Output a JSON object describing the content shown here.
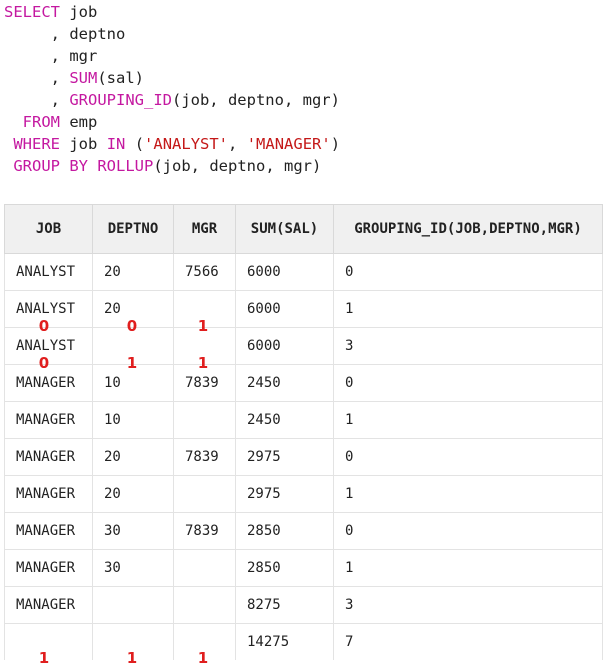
{
  "sql": {
    "lines": [
      [
        {
          "t": "SELECT",
          "c": "kw"
        },
        {
          "t": " job",
          "c": "id"
        }
      ],
      [
        {
          "t": "     , deptno",
          "c": "id"
        }
      ],
      [
        {
          "t": "     , mgr",
          "c": "id"
        }
      ],
      [
        {
          "t": "     , ",
          "c": "id"
        },
        {
          "t": "SUM",
          "c": "fn"
        },
        {
          "t": "(sal)",
          "c": "id"
        }
      ],
      [
        {
          "t": "     , ",
          "c": "id"
        },
        {
          "t": "GROUPING_ID",
          "c": "fn"
        },
        {
          "t": "(job, deptno, mgr)",
          "c": "id"
        }
      ],
      [
        {
          "t": "  ",
          "c": "id"
        },
        {
          "t": "FROM",
          "c": "kw"
        },
        {
          "t": " emp",
          "c": "id"
        }
      ],
      [
        {
          "t": " ",
          "c": "id"
        },
        {
          "t": "WHERE",
          "c": "kw"
        },
        {
          "t": " job ",
          "c": "id"
        },
        {
          "t": "IN",
          "c": "kw"
        },
        {
          "t": " (",
          "c": "id"
        },
        {
          "t": "'ANALYST'",
          "c": "str"
        },
        {
          "t": ", ",
          "c": "id"
        },
        {
          "t": "'MANAGER'",
          "c": "str"
        },
        {
          "t": ")",
          "c": "id"
        }
      ],
      [
        {
          "t": " ",
          "c": "id"
        },
        {
          "t": "GROUP BY",
          "c": "kw"
        },
        {
          "t": " ",
          "c": "id"
        },
        {
          "t": "ROLLUP",
          "c": "fn"
        },
        {
          "t": "(job, deptno, mgr)",
          "c": "id"
        }
      ]
    ]
  },
  "table": {
    "columns": [
      "JOB",
      "DEPTNO",
      "MGR",
      "SUM(SAL)",
      "GROUPING_ID(JOB,DEPTNO,MGR)"
    ],
    "rows": [
      [
        "ANALYST",
        "20",
        "7566",
        "6000",
        "0"
      ],
      [
        "ANALYST",
        "20",
        "",
        "6000",
        "1"
      ],
      [
        "ANALYST",
        "",
        "",
        "6000",
        "3"
      ],
      [
        "MANAGER",
        "10",
        "7839",
        "2450",
        "0"
      ],
      [
        "MANAGER",
        "10",
        "",
        "2450",
        "1"
      ],
      [
        "MANAGER",
        "20",
        "7839",
        "2975",
        "0"
      ],
      [
        "MANAGER",
        "20",
        "",
        "2975",
        "1"
      ],
      [
        "MANAGER",
        "30",
        "7839",
        "2850",
        "0"
      ],
      [
        "MANAGER",
        "30",
        "",
        "2850",
        "1"
      ],
      [
        "MANAGER",
        "",
        "",
        "8275",
        "3"
      ],
      [
        "",
        "",
        "",
        "14275",
        "7"
      ]
    ]
  },
  "annotations": [
    {
      "text": "0",
      "row": 1,
      "col": 0
    },
    {
      "text": "0",
      "row": 1,
      "col": 1
    },
    {
      "text": "1",
      "row": 1,
      "col": 2
    },
    {
      "text": "0",
      "row": 2,
      "col": 0
    },
    {
      "text": "1",
      "row": 2,
      "col": 1
    },
    {
      "text": "1",
      "row": 2,
      "col": 2
    },
    {
      "text": "1",
      "row": 10,
      "col": 0
    },
    {
      "text": "1",
      "row": 10,
      "col": 1
    },
    {
      "text": "1",
      "row": 10,
      "col": 2
    }
  ],
  "colors": {
    "keyword": "#c418a0",
    "string": "#c41818",
    "annotation": "#e01e1e",
    "header_bg": "#f0f0f0"
  }
}
